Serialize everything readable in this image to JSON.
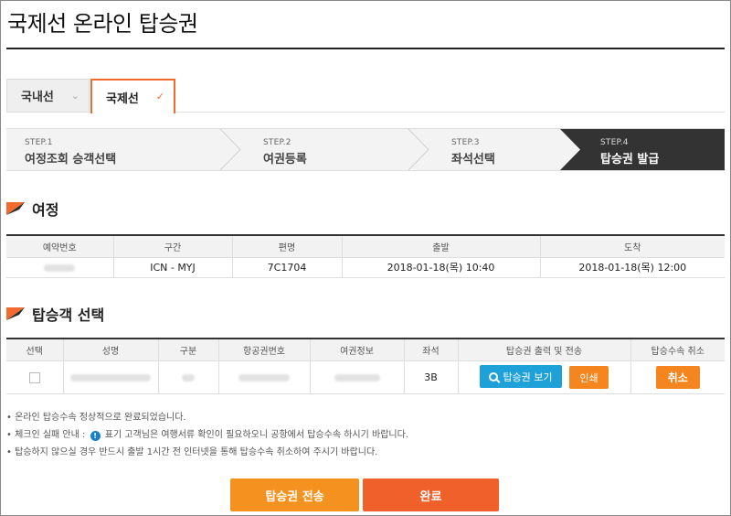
{
  "page": {
    "title": "국제선 온라인 탑승권"
  },
  "tabs": [
    {
      "label": "국내선",
      "active": false
    },
    {
      "label": "국제선",
      "active": true
    }
  ],
  "steps": [
    {
      "num": "STEP.1",
      "label": "여정조회 승객선택",
      "active": false
    },
    {
      "num": "STEP.2",
      "label": "여권등록",
      "active": false
    },
    {
      "num": "STEP.3",
      "label": "좌석선택",
      "active": false
    },
    {
      "num": "STEP.4",
      "label": "탑승권 발급",
      "active": true
    }
  ],
  "itinerary": {
    "title": "여정",
    "headers": [
      "예약번호",
      "구간",
      "편명",
      "출발",
      "도착"
    ],
    "row": {
      "reservation": "",
      "route": "ICN - MYJ",
      "flight": "7C1704",
      "departure": "2018-01-18(목) 10:40",
      "arrival": "2018-01-18(목) 12:00"
    }
  },
  "passengers": {
    "title": "탑승객 선택",
    "headers": [
      "선택",
      "성명",
      "구분",
      "항공권번호",
      "여권정보",
      "좌석",
      "탑승권 출력 및 전송",
      "탑승수속 취소"
    ],
    "row": {
      "seat": "3B"
    },
    "view_label": "탑승권 보기",
    "print_label": "인쇄",
    "cancel_label": "취소"
  },
  "notes": {
    "line1": "• 온라인 탑승수속 정상적으로 완료되었습니다.",
    "line2_prefix": "• 체크인 실패 안내 :",
    "line2_suffix": "표기 고객님은 여행서류 확인이 필요하오니 공항에서 탑승수속 하시기 바랍니다.",
    "line3": "• 탑승하지 않으실 경우 반드시 출발 1시간 전 인터넷을 통해 탑승수속 취소하여 주시기 바랍니다."
  },
  "actions": {
    "send_label": "탑승권 전송",
    "done_label": "완료"
  },
  "colors": {
    "accent": "#f26a2e",
    "blue": "#1ea0d8",
    "orange": "#f5861f",
    "active_step": "#333333"
  }
}
